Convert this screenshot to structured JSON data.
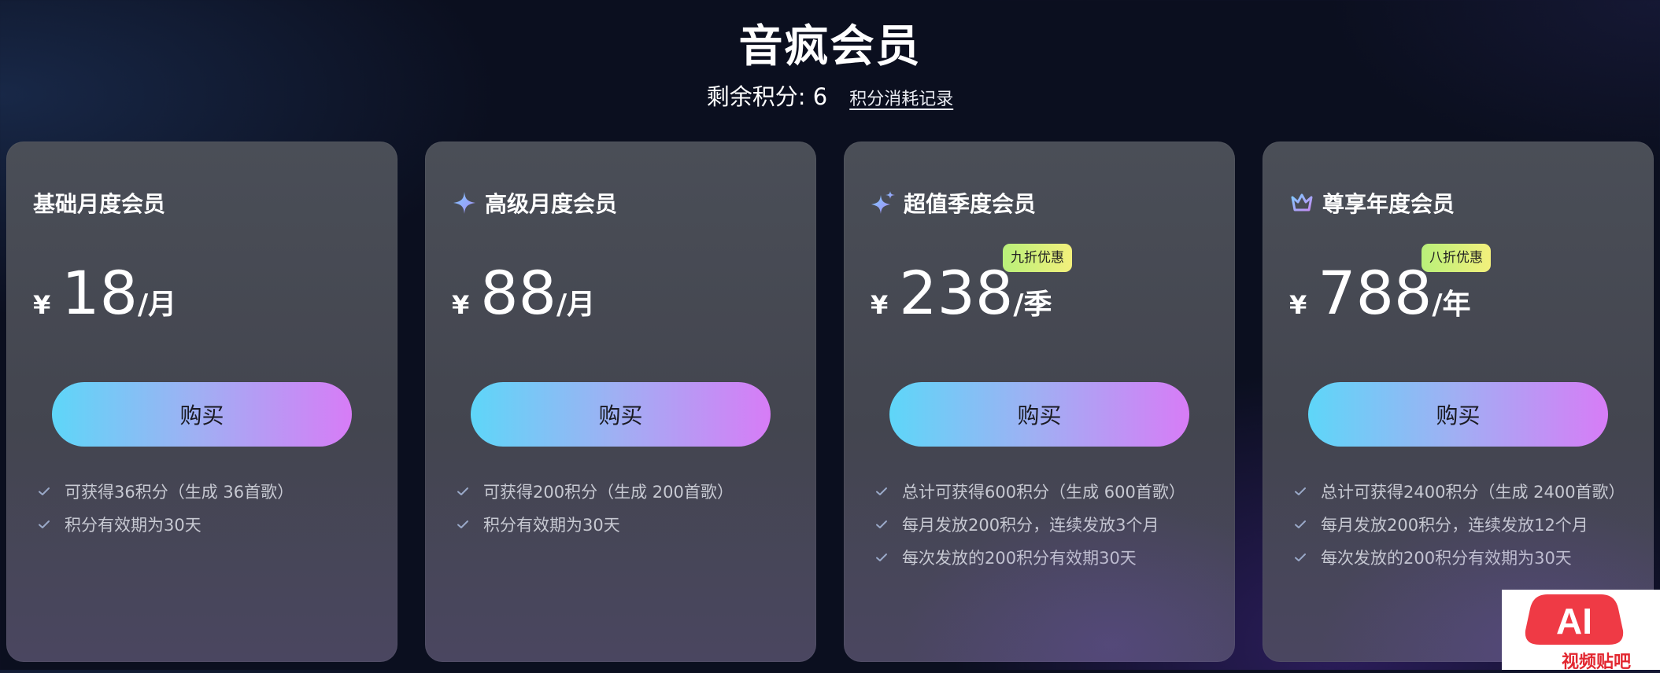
{
  "header": {
    "title": "音疯会员",
    "points_label": "剩余积分: 6",
    "points_link": "积分消耗记录"
  },
  "plans": [
    {
      "title": "基础月度会员",
      "icon": "none",
      "currency": "¥",
      "amount": "18",
      "unit": "/月",
      "badge": "",
      "button": "购买",
      "features": [
        "可获得36积分（生成 36首歌）",
        "积分有效期为30天"
      ]
    },
    {
      "title": "高级月度会员",
      "icon": "sparkle-icon",
      "currency": "¥",
      "amount": "88",
      "unit": "/月",
      "badge": "",
      "button": "购买",
      "features": [
        "可获得200积分（生成 200首歌）",
        "积分有效期为30天"
      ]
    },
    {
      "title": "超值季度会员",
      "icon": "double-sparkle-icon",
      "currency": "¥",
      "amount": "238",
      "unit": "/季",
      "badge": "九折优惠",
      "button": "购买",
      "features": [
        "总计可获得600积分（生成 600首歌）",
        "每月发放200积分，连续发放3个月",
        "每次发放的200积分有效期30天"
      ]
    },
    {
      "title": "尊享年度会员",
      "icon": "crown-icon",
      "currency": "¥",
      "amount": "788",
      "unit": "/年",
      "badge": "八折优惠",
      "button": "购买",
      "features": [
        "总计可获得2400积分（生成 2400首歌）",
        "每月发放200积分，连续发放12个月",
        "每次发放的200积分有效期为30天"
      ]
    }
  ],
  "watermark": {
    "logo_text": "AI",
    "caption": "视频贴吧"
  },
  "colors": {
    "background": "#0b0f1f",
    "card": "#474a53",
    "button_gradient_start": "#5ed6f8",
    "button_gradient_end": "#d77cf6",
    "badge": "#d7f07b",
    "icon_accent": "#8f8cf5"
  }
}
